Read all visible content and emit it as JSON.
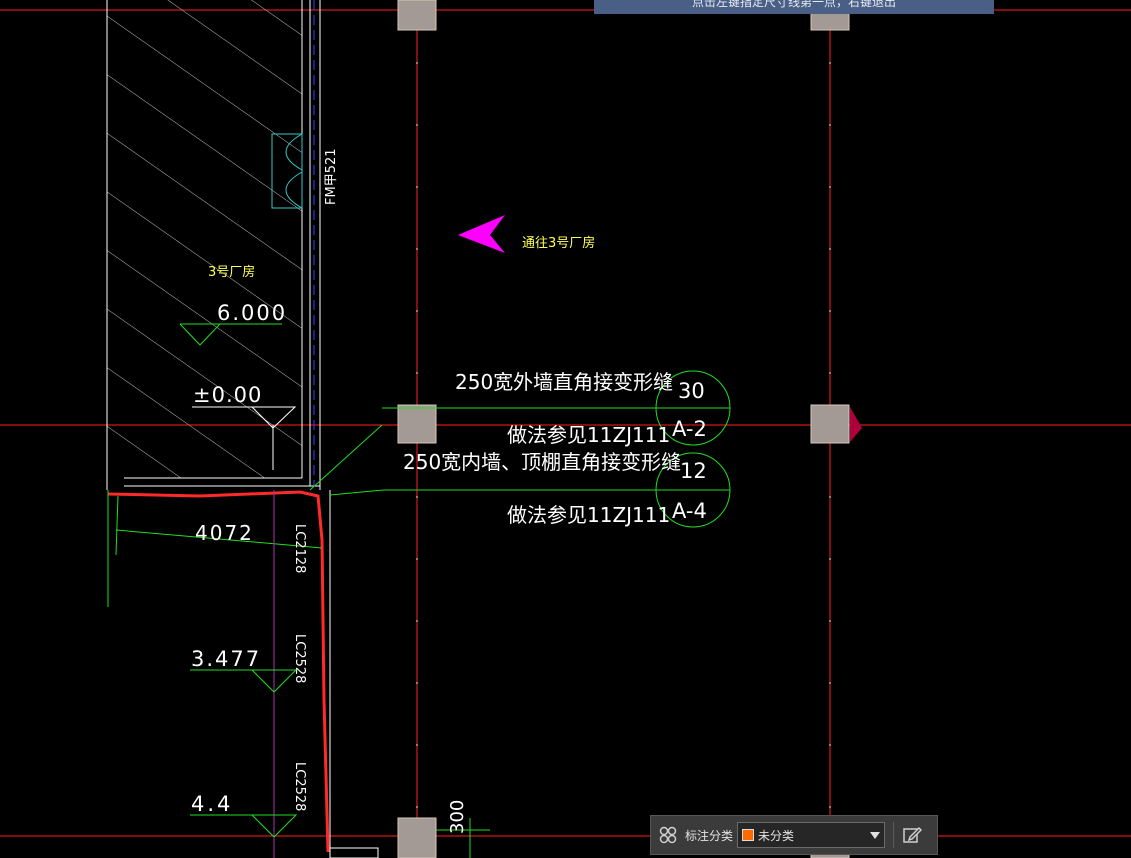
{
  "prompt_text": "点击左键指定尺寸线第一点，右键退出",
  "colors": {
    "background": "#000000",
    "axis": "#ff2020",
    "dimension": "#22dd22",
    "text_white": "#ffffff",
    "text_yellow": "#ffff55",
    "arrow": "#ff00ff",
    "column": "#9a9a9a",
    "selected_line": "#ff2a2a",
    "door": "#33cccc",
    "swatch": "#ff6a00"
  },
  "drawing": {
    "door_label": "FM甲521",
    "direction_label": "通往3号厂房",
    "room_label": "3号厂房",
    "elev_1": "6.000",
    "elev_2": "±0.00",
    "note1_text": "250宽外墙直角接变形缝",
    "note1_ref": "做法参见11ZJ111",
    "note1_num": "30",
    "note1_sheet": "A-2",
    "note2_text": "250宽内墙、顶棚直角接变形缝",
    "note2_ref": "做法参见11ZJ111",
    "note2_num": "12",
    "note2_sheet": "A-4",
    "dim_4072": "4072",
    "window_1": "LC2128",
    "window_2": "LC2528",
    "window_3": "LC2528",
    "elev_3": "3.477",
    "elev_4": "4.4",
    "dim_300": "300"
  },
  "toolbar": {
    "icon": "grid-categories-icon",
    "label": "标注分类",
    "selected_value": "未分类",
    "edit_icon": "edit-icon"
  }
}
